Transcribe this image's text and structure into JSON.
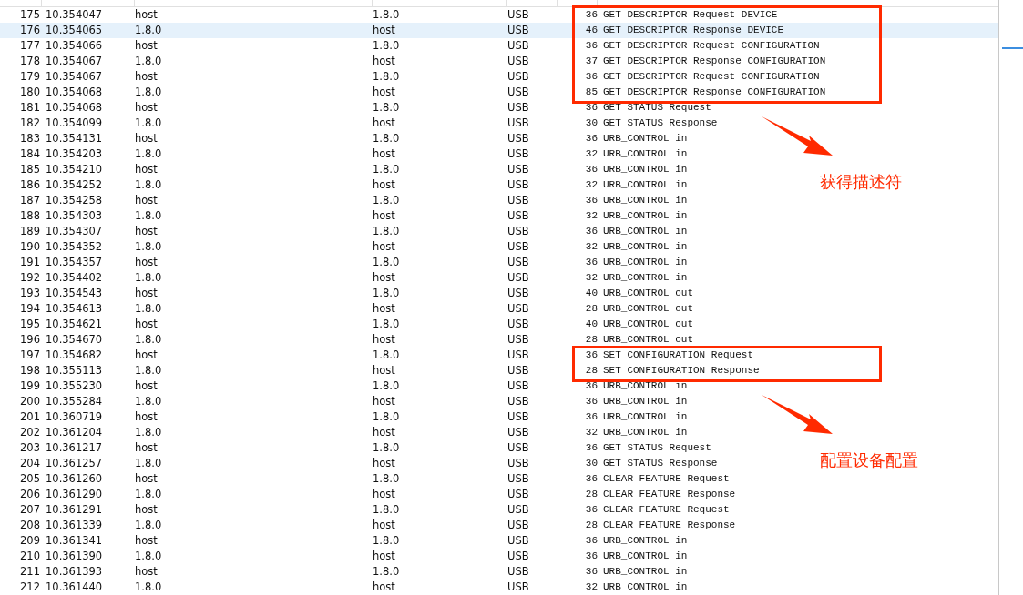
{
  "packet_list": {
    "segments": [
      {
        "callout": "获得描述符",
        "rows": [
          {
            "no": "175",
            "time": "10.354047",
            "source": "host",
            "destination": "1.8.0",
            "protocol": "USB",
            "length": "36",
            "info": "GET DESCRIPTOR Request DEVICE",
            "selected": false
          },
          {
            "no": "176",
            "time": "10.354065",
            "source": "1.8.0",
            "destination": "host",
            "protocol": "USB",
            "length": "46",
            "info": "GET DESCRIPTOR Response DEVICE",
            "selected": true
          },
          {
            "no": "177",
            "time": "10.354066",
            "source": "host",
            "destination": "1.8.0",
            "protocol": "USB",
            "length": "36",
            "info": "GET DESCRIPTOR Request CONFIGURATION",
            "selected": false
          },
          {
            "no": "178",
            "time": "10.354067",
            "source": "1.8.0",
            "destination": "host",
            "protocol": "USB",
            "length": "37",
            "info": "GET DESCRIPTOR Response CONFIGURATION",
            "selected": false
          },
          {
            "no": "179",
            "time": "10.354067",
            "source": "host",
            "destination": "1.8.0",
            "protocol": "USB",
            "length": "36",
            "info": "GET DESCRIPTOR Request CONFIGURATION",
            "selected": false
          },
          {
            "no": "180",
            "time": "10.354068",
            "source": "1.8.0",
            "destination": "host",
            "protocol": "USB",
            "length": "85",
            "info": "GET DESCRIPTOR Response CONFIGURATION",
            "selected": false
          }
        ]
      },
      {
        "rows": [
          {
            "no": "181",
            "time": "10.354068",
            "source": "host",
            "destination": "1.8.0",
            "protocol": "USB",
            "length": "36",
            "info": "GET STATUS Request",
            "selected": false
          },
          {
            "no": "182",
            "time": "10.354099",
            "source": "1.8.0",
            "destination": "host",
            "protocol": "USB",
            "length": "30",
            "info": "GET STATUS Response",
            "selected": false
          },
          {
            "no": "183",
            "time": "10.354131",
            "source": "host",
            "destination": "1.8.0",
            "protocol": "USB",
            "length": "36",
            "info": "URB_CONTROL in",
            "selected": false
          },
          {
            "no": "184",
            "time": "10.354203",
            "source": "1.8.0",
            "destination": "host",
            "protocol": "USB",
            "length": "32",
            "info": "URB_CONTROL in",
            "selected": false
          },
          {
            "no": "185",
            "time": "10.354210",
            "source": "host",
            "destination": "1.8.0",
            "protocol": "USB",
            "length": "36",
            "info": "URB_CONTROL in",
            "selected": false
          },
          {
            "no": "186",
            "time": "10.354252",
            "source": "1.8.0",
            "destination": "host",
            "protocol": "USB",
            "length": "32",
            "info": "URB_CONTROL in",
            "selected": false
          },
          {
            "no": "187",
            "time": "10.354258",
            "source": "host",
            "destination": "1.8.0",
            "protocol": "USB",
            "length": "36",
            "info": "URB_CONTROL in",
            "selected": false
          },
          {
            "no": "188",
            "time": "10.354303",
            "source": "1.8.0",
            "destination": "host",
            "protocol": "USB",
            "length": "32",
            "info": "URB_CONTROL in",
            "selected": false
          },
          {
            "no": "189",
            "time": "10.354307",
            "source": "host",
            "destination": "1.8.0",
            "protocol": "USB",
            "length": "36",
            "info": "URB_CONTROL in",
            "selected": false
          },
          {
            "no": "190",
            "time": "10.354352",
            "source": "1.8.0",
            "destination": "host",
            "protocol": "USB",
            "length": "32",
            "info": "URB_CONTROL in",
            "selected": false
          },
          {
            "no": "191",
            "time": "10.354357",
            "source": "host",
            "destination": "1.8.0",
            "protocol": "USB",
            "length": "36",
            "info": "URB_CONTROL in",
            "selected": false
          },
          {
            "no": "192",
            "time": "10.354402",
            "source": "1.8.0",
            "destination": "host",
            "protocol": "USB",
            "length": "32",
            "info": "URB_CONTROL in",
            "selected": false
          },
          {
            "no": "193",
            "time": "10.354543",
            "source": "host",
            "destination": "1.8.0",
            "protocol": "USB",
            "length": "40",
            "info": "URB_CONTROL out",
            "selected": false
          },
          {
            "no": "194",
            "time": "10.354613",
            "source": "1.8.0",
            "destination": "host",
            "protocol": "USB",
            "length": "28",
            "info": "URB_CONTROL out",
            "selected": false
          },
          {
            "no": "195",
            "time": "10.354621",
            "source": "host",
            "destination": "1.8.0",
            "protocol": "USB",
            "length": "40",
            "info": "URB_CONTROL out",
            "selected": false
          },
          {
            "no": "196",
            "time": "10.354670",
            "source": "1.8.0",
            "destination": "host",
            "protocol": "USB",
            "length": "28",
            "info": "URB_CONTROL out",
            "selected": false
          }
        ]
      },
      {
        "callout": "配置设备配置",
        "rows": [
          {
            "no": "197",
            "time": "10.354682",
            "source": "host",
            "destination": "1.8.0",
            "protocol": "USB",
            "length": "36",
            "info": "SET CONFIGURATION Request",
            "selected": false
          },
          {
            "no": "198",
            "time": "10.355113",
            "source": "1.8.0",
            "destination": "host",
            "protocol": "USB",
            "length": "28",
            "info": "SET CONFIGURATION Response",
            "selected": false
          }
        ]
      },
      {
        "rows": [
          {
            "no": "199",
            "time": "10.355230",
            "source": "host",
            "destination": "1.8.0",
            "protocol": "USB",
            "length": "36",
            "info": "URB_CONTROL in",
            "selected": false
          },
          {
            "no": "200",
            "time": "10.355284",
            "source": "1.8.0",
            "destination": "host",
            "protocol": "USB",
            "length": "36",
            "info": "URB_CONTROL in",
            "selected": false
          },
          {
            "no": "201",
            "time": "10.360719",
            "source": "host",
            "destination": "1.8.0",
            "protocol": "USB",
            "length": "36",
            "info": "URB_CONTROL in",
            "selected": false
          },
          {
            "no": "202",
            "time": "10.361204",
            "source": "1.8.0",
            "destination": "host",
            "protocol": "USB",
            "length": "32",
            "info": "URB_CONTROL in",
            "selected": false
          },
          {
            "no": "203",
            "time": "10.361217",
            "source": "host",
            "destination": "1.8.0",
            "protocol": "USB",
            "length": "36",
            "info": "GET STATUS Request",
            "selected": false
          },
          {
            "no": "204",
            "time": "10.361257",
            "source": "1.8.0",
            "destination": "host",
            "protocol": "USB",
            "length": "30",
            "info": "GET STATUS Response",
            "selected": false
          },
          {
            "no": "205",
            "time": "10.361260",
            "source": "host",
            "destination": "1.8.0",
            "protocol": "USB",
            "length": "36",
            "info": "CLEAR FEATURE Request",
            "selected": false
          },
          {
            "no": "206",
            "time": "10.361290",
            "source": "1.8.0",
            "destination": "host",
            "protocol": "USB",
            "length": "28",
            "info": "CLEAR FEATURE Response",
            "selected": false
          },
          {
            "no": "207",
            "time": "10.361291",
            "source": "host",
            "destination": "1.8.0",
            "protocol": "USB",
            "length": "36",
            "info": "CLEAR FEATURE Request",
            "selected": false
          },
          {
            "no": "208",
            "time": "10.361339",
            "source": "1.8.0",
            "destination": "host",
            "protocol": "USB",
            "length": "28",
            "info": "CLEAR FEATURE Response",
            "selected": false
          },
          {
            "no": "209",
            "time": "10.361341",
            "source": "host",
            "destination": "1.8.0",
            "protocol": "USB",
            "length": "36",
            "info": "URB_CONTROL in",
            "selected": false
          },
          {
            "no": "210",
            "time": "10.361390",
            "source": "1.8.0",
            "destination": "host",
            "protocol": "USB",
            "length": "36",
            "info": "URB_CONTROL in",
            "selected": false
          },
          {
            "no": "211",
            "time": "10.361393",
            "source": "host",
            "destination": "1.8.0",
            "protocol": "USB",
            "length": "36",
            "info": "URB_CONTROL in",
            "selected": false
          },
          {
            "no": "212",
            "time": "10.361440",
            "source": "1.8.0",
            "destination": "host",
            "protocol": "USB",
            "length": "32",
            "info": "URB_CONTROL in",
            "selected": false
          }
        ]
      }
    ]
  }
}
